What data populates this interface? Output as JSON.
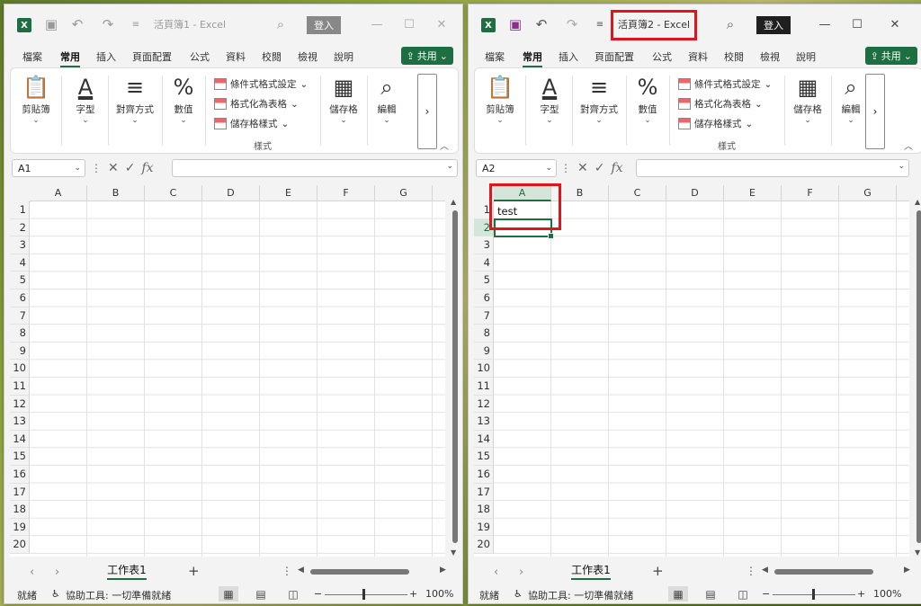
{
  "windows": [
    {
      "title": "活頁簿1 - Excel",
      "signin": "登入",
      "tabs": [
        "檔案",
        "常用",
        "插入",
        "頁面配置",
        "公式",
        "資料",
        "校閱",
        "檢視",
        "說明"
      ],
      "share": "共用",
      "ribbon": {
        "clipboard": "剪貼簿",
        "font": "字型",
        "alignment": "對齊方式",
        "number": "數值",
        "cond_format": "條件式格式設定",
        "format_table": "格式化為表格",
        "cell_styles": "儲存格樣式",
        "styles": "樣式",
        "cells": "儲存格",
        "editing": "編輯",
        "more": "›"
      },
      "name_box": "A1",
      "fx": "fx",
      "columns": [
        "A",
        "B",
        "C",
        "D",
        "E",
        "F",
        "G"
      ],
      "rows": [
        "1",
        "2",
        "3",
        "4",
        "5",
        "6",
        "7",
        "8",
        "9",
        "10",
        "11",
        "12",
        "13",
        "14",
        "15",
        "16",
        "17",
        "18",
        "19",
        "20"
      ],
      "cell_a1": "",
      "sheet_tab": "工作表1",
      "add_sheet": "+",
      "status_ready": "就緒",
      "accessibility": "協助工具: 一切準備就緒",
      "zoom": "100%"
    },
    {
      "title": "活頁簿2 - Excel",
      "signin": "登入",
      "tabs": [
        "檔案",
        "常用",
        "插入",
        "頁面配置",
        "公式",
        "資料",
        "校閱",
        "檢視",
        "說明"
      ],
      "share": "共用",
      "ribbon": {
        "clipboard": "剪貼簿",
        "font": "字型",
        "alignment": "對齊方式",
        "number": "數值",
        "cond_format": "條件式格式設定",
        "format_table": "格式化為表格",
        "cell_styles": "儲存格樣式",
        "styles": "樣式",
        "cells": "儲存格",
        "editing": "編輯",
        "more": "›"
      },
      "name_box": "A2",
      "fx": "fx",
      "columns": [
        "A",
        "B",
        "C",
        "D",
        "E",
        "F",
        "G"
      ],
      "rows": [
        "1",
        "2",
        "3",
        "4",
        "5",
        "6",
        "7",
        "8",
        "9",
        "10",
        "11",
        "12",
        "13",
        "14",
        "15",
        "16",
        "17",
        "18",
        "19",
        "20"
      ],
      "cell_a1": "test",
      "sheet_tab": "工作表1",
      "add_sheet": "+",
      "status_ready": "就緒",
      "accessibility": "協助工具: 一切準備就緒",
      "zoom": "100%"
    }
  ],
  "colors": {
    "accent": "#1d6f42",
    "highlight": "#e0141c"
  }
}
